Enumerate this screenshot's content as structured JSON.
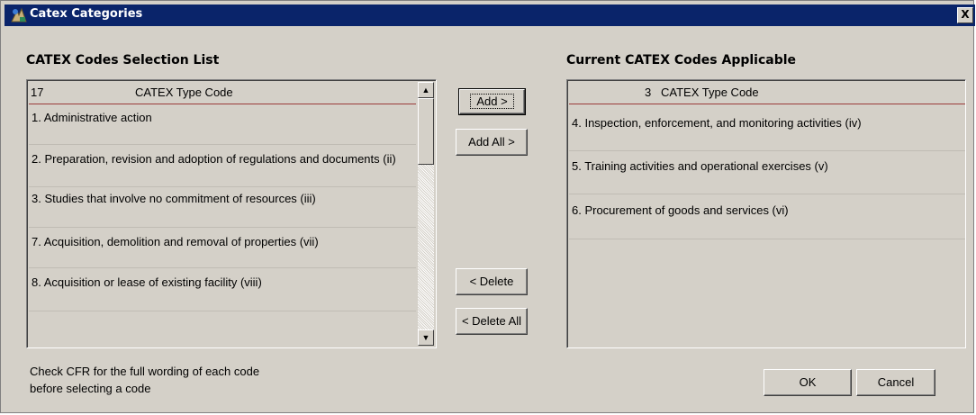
{
  "window": {
    "title": "Catex Categories",
    "close_label": "X"
  },
  "left": {
    "title": "CATEX Codes Selection List",
    "header_count": "17",
    "header_label": "CATEX Type Code",
    "rows": [
      "1. Administrative action",
      "2. Preparation, revision and adoption of regulations and documents (ii)",
      "3. Studies that involve no commitment of resources (iii)",
      "7. Acquisition, demolition and removal of properties (vii)",
      "8. Acquisition or lease of existing facility (viii)",
      ""
    ]
  },
  "right": {
    "title": "Current CATEX Codes Applicable",
    "header_count": "3",
    "header_label": "CATEX Type Code",
    "rows": [
      "4. Inspection, enforcement, and monitoring activities (iv)",
      "5. Training activities and operational exercises (v)",
      "6. Procurement of goods and services (vi)"
    ]
  },
  "buttons": {
    "add": "Add >",
    "add_all": "Add All >",
    "delete": "< Delete",
    "delete_all": "< Delete All",
    "ok": "OK",
    "cancel": "Cancel"
  },
  "footer": {
    "line1": "Check CFR for the full wording of each code",
    "line2": "before selecting a code"
  },
  "colors": {
    "titlebar": "#0a246a",
    "window_bg": "#d4d0c8",
    "header_rule": "#9a3b3b"
  },
  "icons": {
    "app": "catex-app-icon",
    "close": "close-icon",
    "scroll_up": "arrow-up-icon",
    "scroll_down": "arrow-down-icon"
  }
}
